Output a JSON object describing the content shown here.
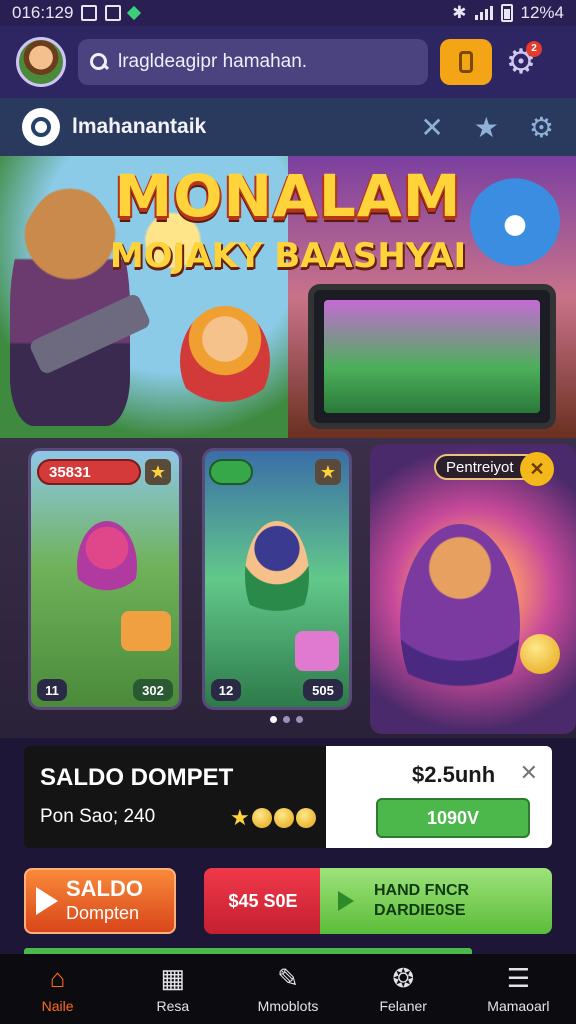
{
  "status_bar": {
    "time": "016:129",
    "battery": "12%4"
  },
  "header": {
    "search_placeholder": "lragldeagipr hamahan.",
    "notification_count": "2"
  },
  "subheader": {
    "brand": "lmahanantaik"
  },
  "hero": {
    "title": "MONALAM",
    "subtitle": "MOJAKY BAASHYAI"
  },
  "cards": [
    {
      "badge": "35831",
      "left_label": "11",
      "right_label": "302"
    },
    {
      "left_label": "12",
      "right_label": "505"
    },
    {
      "badge": "Pentreiyot"
    }
  ],
  "wallet": {
    "title": "SALDO DOMPET",
    "subtitle": "Pon Sao; 240",
    "amount": "$2.5unh",
    "topup_label": "1090V"
  },
  "actions": {
    "orange_title": "SALDO",
    "orange_sub": "Dompten",
    "red_label": "$45 S0E",
    "green_line1": "HAND FNCR",
    "green_line2": "DARDIE0SE"
  },
  "nav": [
    {
      "label": "Naile",
      "icon": "home-icon",
      "active": true
    },
    {
      "label": "Resa",
      "icon": "grid-icon",
      "active": false
    },
    {
      "label": "Mmoblots",
      "icon": "brush-icon",
      "active": false
    },
    {
      "label": "Felaner",
      "icon": "medal-icon",
      "active": false
    },
    {
      "label": "Mamaoarl",
      "icon": "book-icon",
      "active": false
    }
  ],
  "colors": {
    "accent": "#ff6a1a",
    "topup": "#4cb84c",
    "header": "#2e2563"
  }
}
